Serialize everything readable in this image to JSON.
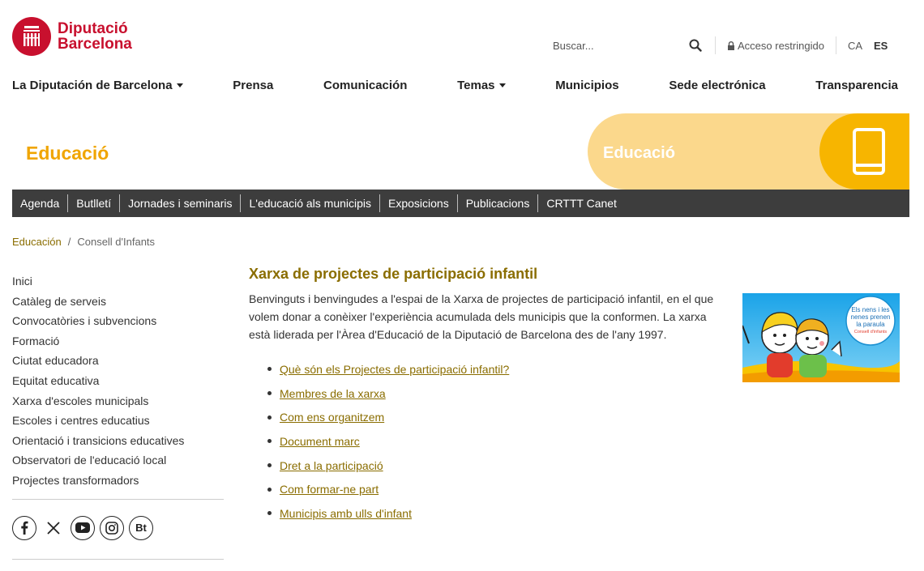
{
  "header": {
    "logo": {
      "line1": "Diputació",
      "line2": "Barcelona"
    },
    "search": {
      "placeholder": "Buscar..."
    },
    "restricted_label": "Acceso restringido",
    "languages": [
      "CA",
      "ES"
    ],
    "active_language": "ES"
  },
  "main_nav": [
    {
      "label": "La Diputación de Barcelona",
      "dropdown": true
    },
    {
      "label": "Prensa",
      "dropdown": false
    },
    {
      "label": "Comunicación",
      "dropdown": false
    },
    {
      "label": "Temas",
      "dropdown": true
    },
    {
      "label": "Municipios",
      "dropdown": false
    },
    {
      "label": "Sede electrónica",
      "dropdown": false
    },
    {
      "label": "Transparencia",
      "dropdown": false
    }
  ],
  "banner": {
    "title": "Educació",
    "badge": "Educació"
  },
  "sub_nav": [
    "Agenda",
    "Butlletí",
    "Jornades i seminaris",
    "L'educació als municipis",
    "Exposicions",
    "Publicacions",
    "CRTTT Canet"
  ],
  "breadcrumb": {
    "home": "Educación",
    "separator": "/",
    "current": "Consell d'Infants"
  },
  "sidebar": {
    "items": [
      "Inici",
      "Catàleg de serveis",
      "Convocatòries i subvencions",
      "Formació",
      "Ciutat educadora",
      "Equitat educativa",
      "Xarxa d'escoles municipals",
      "Escoles i centres educatius",
      "Orientació i transicions educatives",
      "Observatori de l'educació local",
      "Projectes transformadors"
    ],
    "social_bt": "Bt"
  },
  "main": {
    "title": "Xarxa de projectes de participació infantil",
    "intro": "Benvinguts i benvingudes a l'espai de la Xarxa de projectes de participació infantil, en el que volem donar a conèixer l'experiència acumulada dels municipis que la conformen. La xarxa està liderada per l'Àrea d'Educació de la Diputació de Barcelona des de l'any 1997.",
    "links": [
      "Què són els Projectes de participació infantil?",
      "Membres de la xarxa",
      "Com ens organitzem",
      "Document marc",
      "Dret a la participació",
      "Com formar-ne part",
      "Municipis amb ulls d'infant"
    ],
    "image_text": {
      "line1": "Els nens i les",
      "line2": "nenes prenen",
      "line3": "la paraula",
      "line4": "Consell d'infants"
    }
  },
  "colors": {
    "brand_red": "#c8102e",
    "accent_gold": "#8a6d00",
    "banner_yellow": "#f7b500",
    "subnav_bg": "#3d3d3d"
  }
}
